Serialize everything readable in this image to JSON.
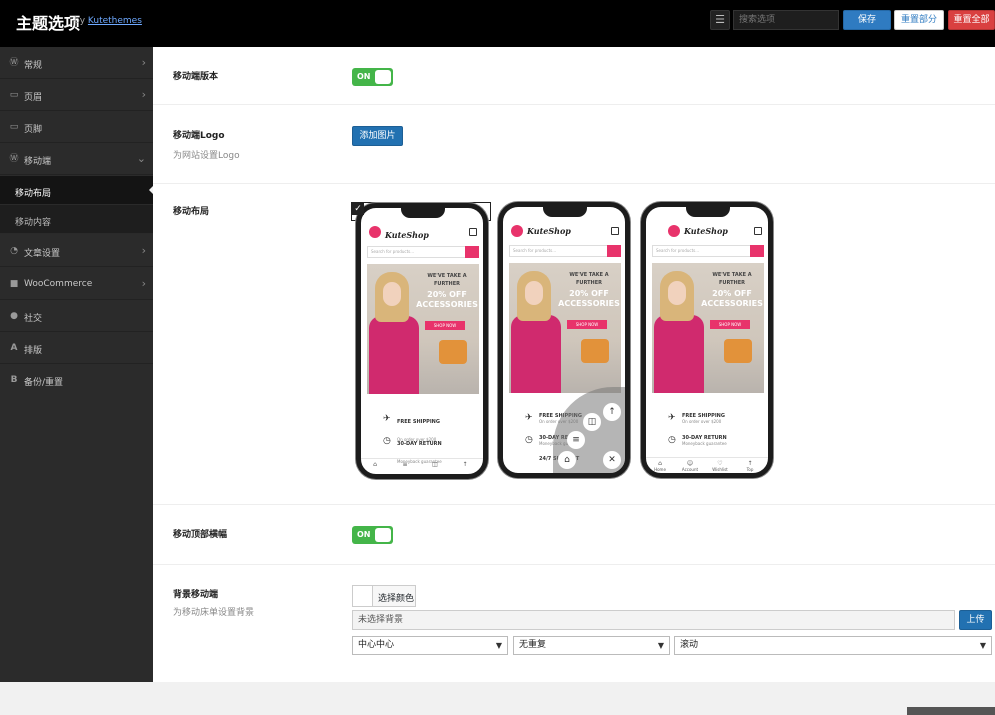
{
  "header": {
    "title": "主题选项",
    "by": "by",
    "brand": "Kutethemes",
    "search_placeholder": "搜索选项",
    "save_label": "保存",
    "reset_section_label": "重置部分",
    "reset_all_label": "重置全部"
  },
  "sidebar": {
    "items": [
      {
        "label": "常规",
        "icon": "wordpress-icon"
      },
      {
        "label": "页眉",
        "icon": "folder-icon"
      },
      {
        "label": "页脚",
        "icon": "folder-icon"
      },
      {
        "label": "移动端",
        "icon": "wordpress-icon"
      },
      {
        "label": "文章设置",
        "icon": "rss-icon"
      },
      {
        "label": "WooCommerce",
        "icon": "bag-icon"
      },
      {
        "label": "社交",
        "icon": "users-icon"
      },
      {
        "label": "排版",
        "icon": "font-icon"
      },
      {
        "label": "备份/重置",
        "icon": "bold-icon"
      }
    ],
    "subitems": [
      {
        "label": "移动布局",
        "active": true
      },
      {
        "label": "移动内容",
        "active": false
      }
    ]
  },
  "fields": {
    "mobile_version": {
      "label": "移动端版本",
      "toggle": "ON"
    },
    "mobile_logo": {
      "label": "移动端Logo",
      "desc": "为网站设置Logo",
      "button": "添加图片"
    },
    "mobile_layout": {
      "label": "移动布局"
    },
    "mobile_header_sticky": {
      "label": "移动顶部横幅",
      "toggle": "ON"
    },
    "bg_mobile": {
      "label": "背景移动端",
      "desc": "为移动床单设置背景",
      "color_button": "选择颜色",
      "image_placeholder": "未选择背景",
      "upload": "上传",
      "position": "中心中心",
      "repeat": "无重复",
      "attachment": "滚动"
    }
  },
  "phones": [
    {
      "selected": true,
      "brand": "KuteShop",
      "search": "Search for products...",
      "promo_small": "WE'VE TAKE A FURTHER",
      "promo_big": "20% OFF ACCESSORIES",
      "shop_now": "SHOP NOW",
      "feature1": "FREE SHIPPING",
      "feature1_sub": "On order over $200",
      "feature2": "30-DAY RETURN",
      "feature2_sub": "Moneyback guarantee",
      "nav": [
        "Home",
        "Menu",
        "Cart",
        "Top"
      ]
    },
    {
      "selected": false,
      "brand": "KuteShop",
      "search": "Search for products...",
      "promo_small": "WE'VE TAKE A FURTHER",
      "promo_big": "20% OFF ACCESSORIES",
      "shop_now": "SHOP NOW",
      "feature1": "FREE SHIPPING",
      "feature1_sub": "On order over $200",
      "feature2": "30-DAY RETURN",
      "feature2_sub": "Moneyback guarantee",
      "feature3": "24/7 SUPPORT",
      "nav": []
    },
    {
      "selected": false,
      "brand": "KuteShop",
      "search": "Search for products...",
      "promo_small": "WE'VE TAKE A FURTHER",
      "promo_big": "20% OFF ACCESSORIES",
      "shop_now": "SHOP NOW",
      "feature1": "FREE SHIPPING",
      "feature1_sub": "On order over $200",
      "feature2": "30-DAY RETURN",
      "feature2_sub": "Moneyback guarantee",
      "nav": [
        "Home",
        "Account",
        "Wishlist",
        "Top"
      ]
    }
  ],
  "colors": {
    "save": "#2f7bc1",
    "reset_all": "#d94040",
    "toggle_on": "#44b549",
    "brand_pink": "#e8336b"
  }
}
